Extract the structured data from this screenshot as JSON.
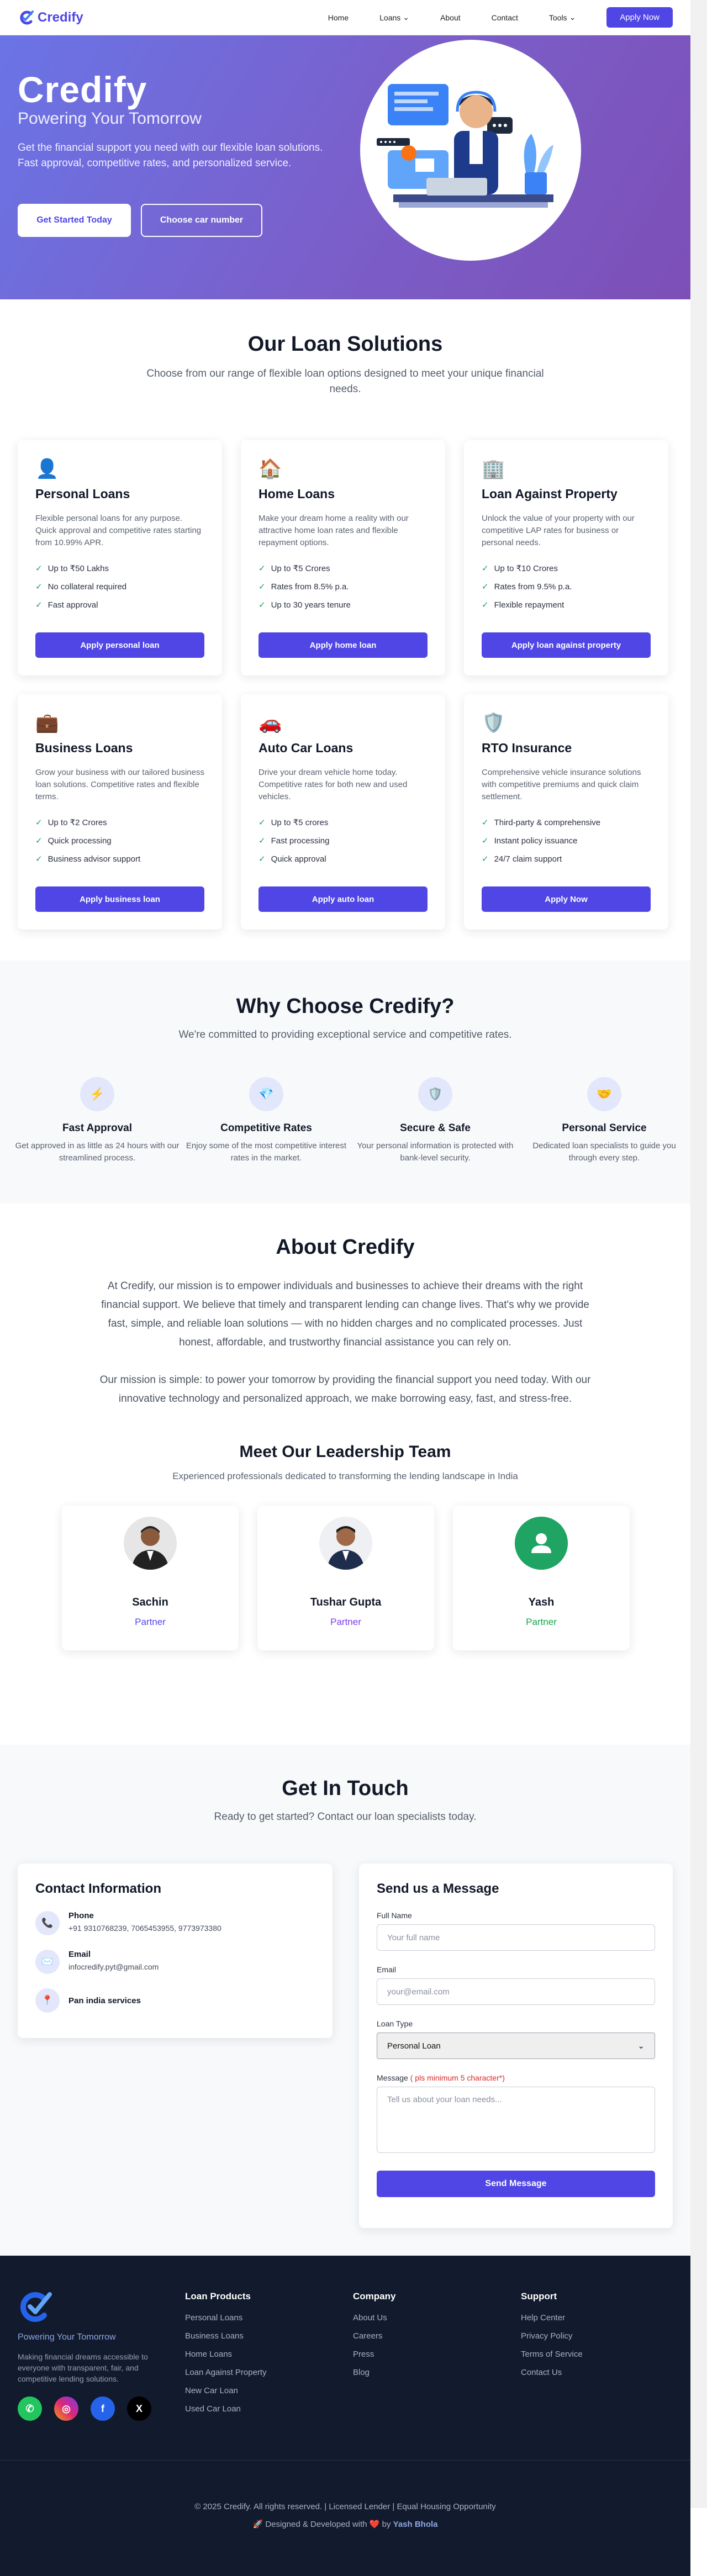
{
  "nav": {
    "brand": "Credify",
    "links": [
      "Home",
      "Loans",
      "About",
      "Contact",
      "Tools"
    ],
    "apply": "Apply Now"
  },
  "hero": {
    "title": "Credify",
    "subtitle": "Powering Your Tomorrow",
    "desc": "Get the financial support you need with our flexible loan solutions. Fast approval, competitive rates, and personalized service.",
    "btn1": "Get Started Today",
    "btn2": "Choose car number"
  },
  "loans": {
    "title": "Our Loan Solutions",
    "subtitle": "Choose from our range of flexible loan options designed to meet your unique financial needs.",
    "cards": [
      {
        "icon": "person-icon",
        "title": "Personal Loans",
        "desc": "Flexible personal loans for any purpose. Quick approval and competitive rates starting from 10.99% APR.",
        "features": [
          "Up to ₹50 Lakhs",
          "No collateral required",
          "Fast approval"
        ],
        "btn": "Apply personal loan"
      },
      {
        "icon": "house-icon",
        "title": "Home Loans",
        "desc": "Make your dream home a reality with our attractive home loan rates and flexible repayment options.",
        "features": [
          "Up to ₹5 Crores",
          "Rates from 8.5% p.a.",
          "Up to 30 years tenure"
        ],
        "btn": "Apply home loan"
      },
      {
        "icon": "building-icon",
        "title": "Loan Against Property",
        "desc": "Unlock the value of your property with our competitive LAP rates for business or personal needs.",
        "features": [
          "Up to ₹10 Crores",
          "Rates from 9.5% p.a.",
          "Flexible repayment"
        ],
        "btn": "Apply loan against property"
      },
      {
        "icon": "briefcase-icon",
        "title": "Business Loans",
        "desc": "Grow your business with our tailored business loan solutions. Competitive rates and flexible terms.",
        "features": [
          "Up to ₹2 Crores",
          "Quick processing",
          "Business advisor support"
        ],
        "btn": "Apply business loan"
      },
      {
        "icon": "car-icon",
        "title": "Auto Car Loans",
        "desc": "Drive your dream vehicle home today. Competitive rates for both new and used vehicles.",
        "features": [
          "Up to ₹5 crores",
          "Fast processing",
          "Quick approval"
        ],
        "btn": "Apply auto loan"
      },
      {
        "icon": "shield-icon",
        "title": "RTO Insurance",
        "desc": "Comprehensive vehicle insurance solutions with competitive premiums and quick claim settlement.",
        "features": [
          "Third-party & comprehensive",
          "Instant policy issuance",
          "24/7 claim support"
        ],
        "btn": "Apply Now"
      }
    ]
  },
  "why": {
    "title": "Why Choose Credify?",
    "subtitle": "We're committed to providing exceptional service and competitive rates.",
    "items": [
      {
        "icon": "lightning-icon",
        "title": "Fast Approval",
        "desc": "Get approved in as little as 24 hours with our streamlined process."
      },
      {
        "icon": "diamond-icon",
        "title": "Competitive Rates",
        "desc": "Enjoy some of the most competitive interest rates in the market."
      },
      {
        "icon": "shield-icon",
        "title": "Secure & Safe",
        "desc": "Your personal information is protected with bank-level security."
      },
      {
        "icon": "handshake-icon",
        "title": "Personal Service",
        "desc": "Dedicated loan specialists to guide you through every step."
      }
    ]
  },
  "about": {
    "title": "About Credify",
    "p1": "At Credify, our mission is to empower individuals and businesses to achieve their dreams with the right financial support. We believe that timely and transparent lending can change lives. That's why we provide fast, simple, and reliable loan solutions — with no hidden charges and no complicated processes. Just honest, affordable, and trustworthy financial assistance you can rely on.",
    "p2": "Our mission is simple: to power your tomorrow by providing the financial support you need today. With our innovative technology and personalized approach, we make borrowing easy, fast, and stress-free.",
    "team_title": "Meet Our Leadership Team",
    "team_sub": "Experienced professionals dedicated to transforming the lending landscape in India",
    "team": [
      {
        "name": "Sachin",
        "role": "Partner",
        "color": "#4f46e5"
      },
      {
        "name": "Tushar Gupta",
        "role": "Partner",
        "color": "#7c3aed"
      },
      {
        "name": "Yash",
        "role": "Partner",
        "color": "#16a34a"
      }
    ]
  },
  "contact": {
    "title": "Get In Touch",
    "subtitle": "Ready to get started? Contact our loan specialists today.",
    "info_title": "Contact Information",
    "phone_label": "Phone",
    "phone": "+91 9310768239, 7065453955, 9773973380",
    "email_label": "Email",
    "email": "infocredify.pyt@gmail.com",
    "location": "Pan india services",
    "form_title": "Send us a Message",
    "name_label": "Full Name",
    "name_ph": "Your full name",
    "email_field_label": "Email",
    "email_ph": "your@email.com",
    "type_label": "Loan Type",
    "type_value": "Personal Loan",
    "msg_label": "Message",
    "msg_hint": "( pls minimum 5 character*)",
    "msg_ph": "Tell us about your loan needs...",
    "send": "Send Message"
  },
  "footer": {
    "tagline": "Powering Your Tomorrow",
    "desc": "Making financial dreams accessible to everyone with transparent, fair, and competitive lending solutions.",
    "products_title": "Loan Products",
    "products": [
      "Personal Loans",
      "Business Loans",
      "Home Loans",
      "Loan Against Property",
      "New Car Loan",
      "Used Car Loan"
    ],
    "company_title": "Company",
    "company": [
      "About Us",
      "Careers",
      "Press",
      "Blog"
    ],
    "support_title": "Support",
    "support": [
      "Help Center",
      "Privacy Policy",
      "Terms of Service",
      "Contact Us"
    ],
    "copyright": "© 2025 Credify. All rights reserved. | Licensed Lender | Equal Housing Opportunity",
    "credit_prefix": "🚀 Designed & Developed with ❤️ by",
    "credit_name": "Yash Bhola"
  },
  "colors": {
    "accent": "#4f46e5",
    "check": "#16a34a",
    "footer_bg": "#121a2d"
  }
}
